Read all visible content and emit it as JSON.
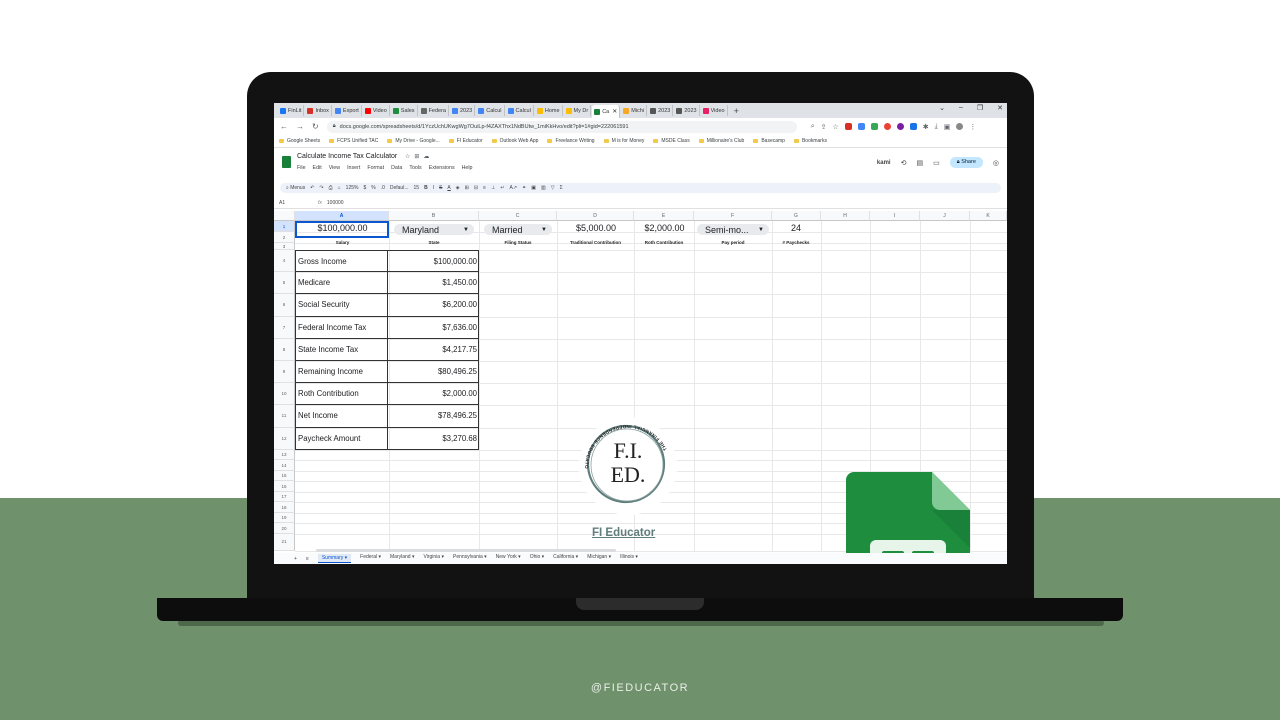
{
  "browser": {
    "tabs": [
      {
        "label": "FinLit",
        "color": "#1877f2"
      },
      {
        "label": "Inbox",
        "color": "#d93025"
      },
      {
        "label": "Export",
        "color": "#4285f4"
      },
      {
        "label": "Video",
        "color": "#ff0000"
      },
      {
        "label": "Sales",
        "color": "#1e8e3e"
      },
      {
        "label": "Federa",
        "color": "#666666"
      },
      {
        "label": "2023",
        "color": "#4285f4"
      },
      {
        "label": "Calcul",
        "color": "#4285f4"
      },
      {
        "label": "Calcul",
        "color": "#4285f4"
      },
      {
        "label": "Home",
        "color": "#fbbc04"
      },
      {
        "label": "My Dr",
        "color": "#fbbc04"
      },
      {
        "label": "Ca",
        "color": "#188038"
      },
      {
        "label": "Michi",
        "color": "#f9a825"
      },
      {
        "label": "2023",
        "color": "#555555"
      },
      {
        "label": "2023",
        "color": "#555555"
      },
      {
        "label": "Video",
        "color": "#e91e63"
      }
    ],
    "active_tab_index": 11,
    "new_tab": "+",
    "url": "docs.google.com/spreadsheets/d/1YczUchUKwgWg7OuiLp-f4ZAXThx1NdBUtw_1miKkHvo/edit?pli=1#gid=222061591",
    "bookmarks": [
      "Google Sheets",
      "FCPS Unified TAC",
      "My Drive - Google...",
      "FI Educator",
      "Outlook Web App",
      "Freelance Writing",
      "M is for Money",
      "MSDE Class",
      "Millionaire's Club",
      "Basecamp",
      "Bookmarks"
    ]
  },
  "sheets": {
    "title": "Calculate Income Tax Calculator",
    "menus": [
      "File",
      "Edit",
      "View",
      "Insert",
      "Format",
      "Data",
      "Tools",
      "Extensions",
      "Help"
    ],
    "kami_label": "kami",
    "share_label": "Share",
    "toolbar": {
      "menus": "Menus",
      "zoom": "125%",
      "font": "Defaul...",
      "font_size": "15"
    },
    "name_box": "A1",
    "formula_value": "100000",
    "columns": [
      "A",
      "B",
      "C",
      "D",
      "E",
      "F",
      "G",
      "H",
      "I",
      "J",
      "K"
    ],
    "rows": [
      "1",
      "2",
      "3",
      "4",
      "5",
      "6",
      "7",
      "8",
      "9",
      "10",
      "11",
      "12",
      "13",
      "14",
      "15",
      "16",
      "17",
      "18",
      "19",
      "20",
      "21"
    ],
    "inputs": {
      "salary": "$100,000.00",
      "state": "Maryland",
      "filing_status": "Married",
      "traditional": "$5,000.00",
      "roth": "$2,000.00",
      "pay_period": "Semi-mo...",
      "paychecks": "24"
    },
    "input_labels": {
      "salary": "Salary",
      "state": "State",
      "filing_status": "Filing Status",
      "traditional": "Traditional Contribution",
      "roth": "Roth Contribution",
      "pay_period": "Pay period",
      "paychecks": "# Paychecks"
    },
    "summary_rows": [
      {
        "label": "Gross Income",
        "value": "$100,000.00"
      },
      {
        "label": "Medicare",
        "value": "$1,450.00"
      },
      {
        "label": "Social Security",
        "value": "$6,200.00"
      },
      {
        "label": "Federal Income Tax",
        "value": "$7,636.00"
      },
      {
        "label": "State Income Tax",
        "value": "$4,217.75"
      },
      {
        "label": "Remaining Income",
        "value": "$80,496.25"
      },
      {
        "label": "Roth Contribution",
        "value": "$2,000.00"
      },
      {
        "label": "Net Income",
        "value": "$78,496.25"
      },
      {
        "label": "Paycheck Amount",
        "value": "$3,270.68"
      }
    ],
    "logo": {
      "initials_top": "F.I.",
      "initials_bottom": "ED.",
      "ring_text": "THE FINANCIAL INDEPENDENCE EDUCATOR",
      "link_text": "FI Educator"
    },
    "sheet_tabs": [
      "Summary",
      "Federal",
      "Maryland",
      "Virginia",
      "Pennsylvania",
      "New York",
      "Ohio",
      "California",
      "Michigan",
      "Illinois"
    ],
    "active_sheet": "Summary"
  },
  "footer": {
    "handle": "@FIEDUCATOR"
  },
  "colors": {
    "green_band": "#6f916c",
    "sheets_green": "#188038",
    "logo_teal": "#5e7d7b"
  }
}
